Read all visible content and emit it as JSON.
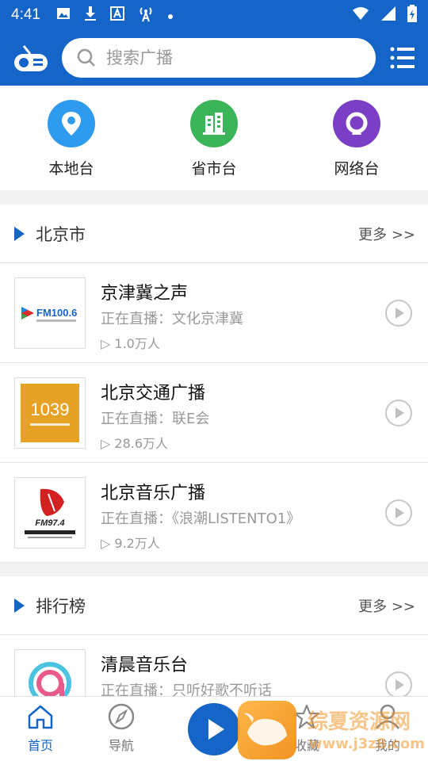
{
  "status_bar": {
    "time": "4:41"
  },
  "header": {
    "search_placeholder": "搜索广播"
  },
  "categories": [
    {
      "label": "本地台",
      "color": "#2f9bef"
    },
    {
      "label": "省市台",
      "color": "#3cb45a"
    },
    {
      "label": "网络台",
      "color": "#7a3fc4"
    }
  ],
  "sections": [
    {
      "title": "北京市",
      "more": "更多 >>",
      "items": [
        {
          "name": "京津冀之声",
          "live": "正在直播：文化京津冀",
          "count": "▷ 1.0万人",
          "logo_text": "FM100.6"
        },
        {
          "name": "北京交通广播",
          "live": "正在直播：联E会",
          "count": "▷ 28.6万人",
          "logo_text": "1039"
        },
        {
          "name": "北京音乐广播",
          "live": "正在直播：《浪潮LISTENTO1》",
          "count": "▷ 9.2万人",
          "logo_text": "FM97.4"
        }
      ]
    },
    {
      "title": "排行榜",
      "more": "更多 >>",
      "items": [
        {
          "name": "清晨音乐台",
          "live": "正在直播：只听好歌不听话",
          "count": "",
          "logo_text": ""
        }
      ]
    }
  ],
  "bottom_nav": {
    "tabs": [
      {
        "label": "首页",
        "icon": "home-icon"
      },
      {
        "label": "导航",
        "icon": "compass-icon"
      },
      {
        "label": "收藏",
        "icon": "star-icon"
      },
      {
        "label": "我的",
        "icon": "user-icon"
      }
    ]
  },
  "watermark": {
    "text": "综夏资源网",
    "url": "www.j3z8.com"
  },
  "colors": {
    "primary": "#1565c8"
  }
}
